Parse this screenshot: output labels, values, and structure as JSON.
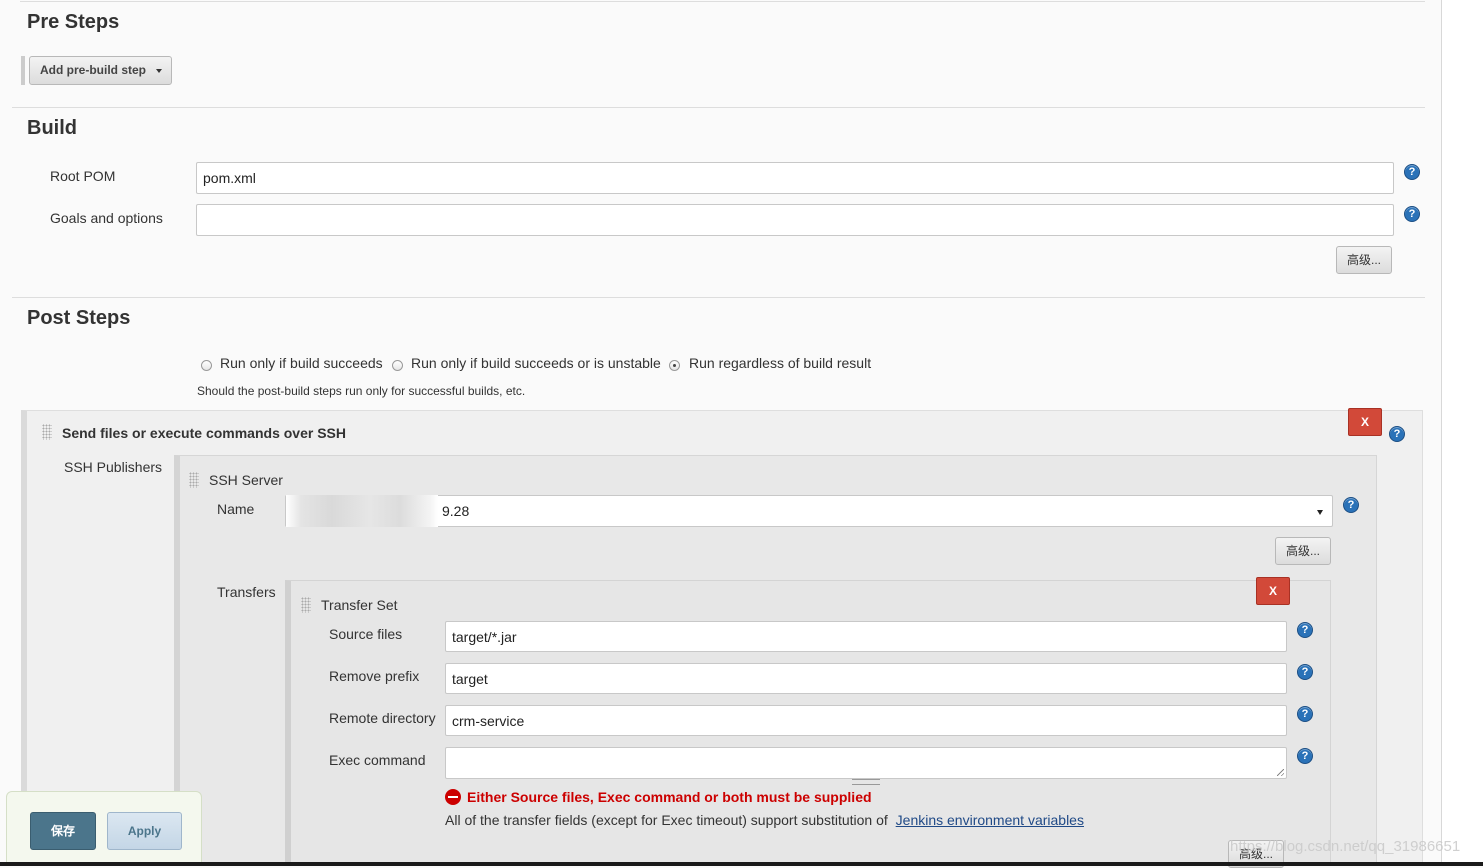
{
  "pre_steps": {
    "title": "Pre Steps",
    "add_button": "Add pre-build step"
  },
  "build": {
    "title": "Build",
    "root_pom_label": "Root POM",
    "root_pom_value": "pom.xml",
    "goals_label": "Goals and options",
    "goals_value": "",
    "advanced_button": "高级..."
  },
  "post_steps": {
    "title": "Post Steps",
    "options": [
      "Run only if build succeeds",
      "Run only if build succeeds or is unstable",
      "Run regardless of build result"
    ],
    "selected_index": 2,
    "hint": "Should the post-build steps run only for successful builds, etc."
  },
  "ssh_step": {
    "title": "Send files or execute commands over SSH",
    "delete_label": "X",
    "publishers_label": "SSH Publishers",
    "server": {
      "title": "SSH Server",
      "name_label": "Name",
      "name_value": "9.28",
      "advanced_button": "高级..."
    },
    "transfers_label": "Transfers",
    "transfer_set": {
      "title": "Transfer Set",
      "delete_label": "X",
      "source_files_label": "Source files",
      "source_files_value": "target/*.jar",
      "remove_prefix_label": "Remove prefix",
      "remove_prefix_value": "target",
      "remote_directory_label": "Remote directory",
      "remote_directory_value": "crm-service",
      "exec_command_label": "Exec command",
      "exec_command_value": "",
      "error_message": "Either Source files, Exec command or both must be supplied",
      "info_text": "All of the transfer fields (except for Exec timeout) support substitution of",
      "info_link": "Jenkins environment variables",
      "advanced_button": "高级..."
    }
  },
  "footer": {
    "save_button": "保存",
    "apply_button": "Apply"
  },
  "watermark": "https://blog.csdn.net/qq_31986651",
  "help_glyph": "?",
  "colors": {
    "help_blue": "#2a72b8",
    "delete_red": "#d24939",
    "error_red": "#cc0000",
    "save_blue": "#4b758b"
  }
}
